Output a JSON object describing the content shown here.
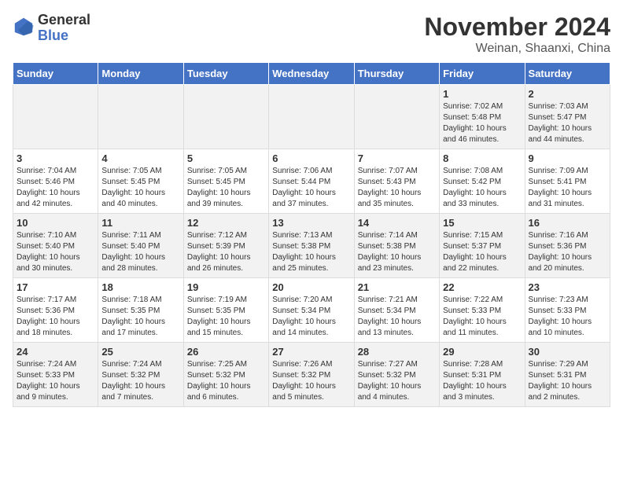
{
  "header": {
    "logo_line1": "General",
    "logo_line2": "Blue",
    "title": "November 2024",
    "subtitle": "Weinan, Shaanxi, China"
  },
  "days_of_week": [
    "Sunday",
    "Monday",
    "Tuesday",
    "Wednesday",
    "Thursday",
    "Friday",
    "Saturday"
  ],
  "weeks": [
    [
      {
        "day": "",
        "info": ""
      },
      {
        "day": "",
        "info": ""
      },
      {
        "day": "",
        "info": ""
      },
      {
        "day": "",
        "info": ""
      },
      {
        "day": "",
        "info": ""
      },
      {
        "day": "1",
        "info": "Sunrise: 7:02 AM\nSunset: 5:48 PM\nDaylight: 10 hours and 46 minutes."
      },
      {
        "day": "2",
        "info": "Sunrise: 7:03 AM\nSunset: 5:47 PM\nDaylight: 10 hours and 44 minutes."
      }
    ],
    [
      {
        "day": "3",
        "info": "Sunrise: 7:04 AM\nSunset: 5:46 PM\nDaylight: 10 hours and 42 minutes."
      },
      {
        "day": "4",
        "info": "Sunrise: 7:05 AM\nSunset: 5:45 PM\nDaylight: 10 hours and 40 minutes."
      },
      {
        "day": "5",
        "info": "Sunrise: 7:05 AM\nSunset: 5:45 PM\nDaylight: 10 hours and 39 minutes."
      },
      {
        "day": "6",
        "info": "Sunrise: 7:06 AM\nSunset: 5:44 PM\nDaylight: 10 hours and 37 minutes."
      },
      {
        "day": "7",
        "info": "Sunrise: 7:07 AM\nSunset: 5:43 PM\nDaylight: 10 hours and 35 minutes."
      },
      {
        "day": "8",
        "info": "Sunrise: 7:08 AM\nSunset: 5:42 PM\nDaylight: 10 hours and 33 minutes."
      },
      {
        "day": "9",
        "info": "Sunrise: 7:09 AM\nSunset: 5:41 PM\nDaylight: 10 hours and 31 minutes."
      }
    ],
    [
      {
        "day": "10",
        "info": "Sunrise: 7:10 AM\nSunset: 5:40 PM\nDaylight: 10 hours and 30 minutes."
      },
      {
        "day": "11",
        "info": "Sunrise: 7:11 AM\nSunset: 5:40 PM\nDaylight: 10 hours and 28 minutes."
      },
      {
        "day": "12",
        "info": "Sunrise: 7:12 AM\nSunset: 5:39 PM\nDaylight: 10 hours and 26 minutes."
      },
      {
        "day": "13",
        "info": "Sunrise: 7:13 AM\nSunset: 5:38 PM\nDaylight: 10 hours and 25 minutes."
      },
      {
        "day": "14",
        "info": "Sunrise: 7:14 AM\nSunset: 5:38 PM\nDaylight: 10 hours and 23 minutes."
      },
      {
        "day": "15",
        "info": "Sunrise: 7:15 AM\nSunset: 5:37 PM\nDaylight: 10 hours and 22 minutes."
      },
      {
        "day": "16",
        "info": "Sunrise: 7:16 AM\nSunset: 5:36 PM\nDaylight: 10 hours and 20 minutes."
      }
    ],
    [
      {
        "day": "17",
        "info": "Sunrise: 7:17 AM\nSunset: 5:36 PM\nDaylight: 10 hours and 18 minutes."
      },
      {
        "day": "18",
        "info": "Sunrise: 7:18 AM\nSunset: 5:35 PM\nDaylight: 10 hours and 17 minutes."
      },
      {
        "day": "19",
        "info": "Sunrise: 7:19 AM\nSunset: 5:35 PM\nDaylight: 10 hours and 15 minutes."
      },
      {
        "day": "20",
        "info": "Sunrise: 7:20 AM\nSunset: 5:34 PM\nDaylight: 10 hours and 14 minutes."
      },
      {
        "day": "21",
        "info": "Sunrise: 7:21 AM\nSunset: 5:34 PM\nDaylight: 10 hours and 13 minutes."
      },
      {
        "day": "22",
        "info": "Sunrise: 7:22 AM\nSunset: 5:33 PM\nDaylight: 10 hours and 11 minutes."
      },
      {
        "day": "23",
        "info": "Sunrise: 7:23 AM\nSunset: 5:33 PM\nDaylight: 10 hours and 10 minutes."
      }
    ],
    [
      {
        "day": "24",
        "info": "Sunrise: 7:24 AM\nSunset: 5:33 PM\nDaylight: 10 hours and 9 minutes."
      },
      {
        "day": "25",
        "info": "Sunrise: 7:24 AM\nSunset: 5:32 PM\nDaylight: 10 hours and 7 minutes."
      },
      {
        "day": "26",
        "info": "Sunrise: 7:25 AM\nSunset: 5:32 PM\nDaylight: 10 hours and 6 minutes."
      },
      {
        "day": "27",
        "info": "Sunrise: 7:26 AM\nSunset: 5:32 PM\nDaylight: 10 hours and 5 minutes."
      },
      {
        "day": "28",
        "info": "Sunrise: 7:27 AM\nSunset: 5:32 PM\nDaylight: 10 hours and 4 minutes."
      },
      {
        "day": "29",
        "info": "Sunrise: 7:28 AM\nSunset: 5:31 PM\nDaylight: 10 hours and 3 minutes."
      },
      {
        "day": "30",
        "info": "Sunrise: 7:29 AM\nSunset: 5:31 PM\nDaylight: 10 hours and 2 minutes."
      }
    ]
  ]
}
